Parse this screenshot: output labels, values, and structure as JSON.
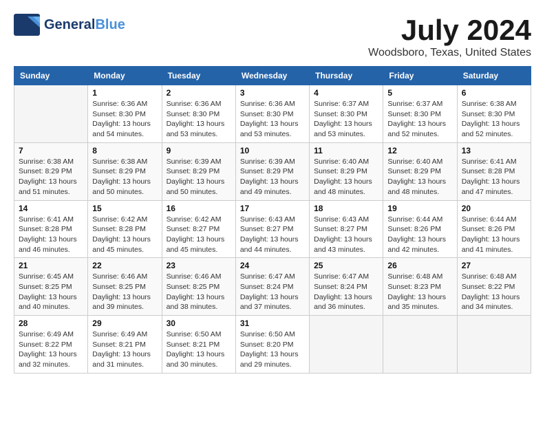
{
  "header": {
    "logo_general": "General",
    "logo_blue": "Blue",
    "month": "July 2024",
    "location": "Woodsboro, Texas, United States"
  },
  "days_of_week": [
    "Sunday",
    "Monday",
    "Tuesday",
    "Wednesday",
    "Thursday",
    "Friday",
    "Saturday"
  ],
  "weeks": [
    [
      {
        "day": "",
        "sunrise": "",
        "sunset": "",
        "daylight": ""
      },
      {
        "day": "1",
        "sunrise": "Sunrise: 6:36 AM",
        "sunset": "Sunset: 8:30 PM",
        "daylight": "Daylight: 13 hours and 54 minutes."
      },
      {
        "day": "2",
        "sunrise": "Sunrise: 6:36 AM",
        "sunset": "Sunset: 8:30 PM",
        "daylight": "Daylight: 13 hours and 53 minutes."
      },
      {
        "day": "3",
        "sunrise": "Sunrise: 6:36 AM",
        "sunset": "Sunset: 8:30 PM",
        "daylight": "Daylight: 13 hours and 53 minutes."
      },
      {
        "day": "4",
        "sunrise": "Sunrise: 6:37 AM",
        "sunset": "Sunset: 8:30 PM",
        "daylight": "Daylight: 13 hours and 53 minutes."
      },
      {
        "day": "5",
        "sunrise": "Sunrise: 6:37 AM",
        "sunset": "Sunset: 8:30 PM",
        "daylight": "Daylight: 13 hours and 52 minutes."
      },
      {
        "day": "6",
        "sunrise": "Sunrise: 6:38 AM",
        "sunset": "Sunset: 8:30 PM",
        "daylight": "Daylight: 13 hours and 52 minutes."
      }
    ],
    [
      {
        "day": "7",
        "sunrise": "Sunrise: 6:38 AM",
        "sunset": "Sunset: 8:29 PM",
        "daylight": "Daylight: 13 hours and 51 minutes."
      },
      {
        "day": "8",
        "sunrise": "Sunrise: 6:38 AM",
        "sunset": "Sunset: 8:29 PM",
        "daylight": "Daylight: 13 hours and 50 minutes."
      },
      {
        "day": "9",
        "sunrise": "Sunrise: 6:39 AM",
        "sunset": "Sunset: 8:29 PM",
        "daylight": "Daylight: 13 hours and 50 minutes."
      },
      {
        "day": "10",
        "sunrise": "Sunrise: 6:39 AM",
        "sunset": "Sunset: 8:29 PM",
        "daylight": "Daylight: 13 hours and 49 minutes."
      },
      {
        "day": "11",
        "sunrise": "Sunrise: 6:40 AM",
        "sunset": "Sunset: 8:29 PM",
        "daylight": "Daylight: 13 hours and 48 minutes."
      },
      {
        "day": "12",
        "sunrise": "Sunrise: 6:40 AM",
        "sunset": "Sunset: 8:29 PM",
        "daylight": "Daylight: 13 hours and 48 minutes."
      },
      {
        "day": "13",
        "sunrise": "Sunrise: 6:41 AM",
        "sunset": "Sunset: 8:28 PM",
        "daylight": "Daylight: 13 hours and 47 minutes."
      }
    ],
    [
      {
        "day": "14",
        "sunrise": "Sunrise: 6:41 AM",
        "sunset": "Sunset: 8:28 PM",
        "daylight": "Daylight: 13 hours and 46 minutes."
      },
      {
        "day": "15",
        "sunrise": "Sunrise: 6:42 AM",
        "sunset": "Sunset: 8:28 PM",
        "daylight": "Daylight: 13 hours and 45 minutes."
      },
      {
        "day": "16",
        "sunrise": "Sunrise: 6:42 AM",
        "sunset": "Sunset: 8:27 PM",
        "daylight": "Daylight: 13 hours and 45 minutes."
      },
      {
        "day": "17",
        "sunrise": "Sunrise: 6:43 AM",
        "sunset": "Sunset: 8:27 PM",
        "daylight": "Daylight: 13 hours and 44 minutes."
      },
      {
        "day": "18",
        "sunrise": "Sunrise: 6:43 AM",
        "sunset": "Sunset: 8:27 PM",
        "daylight": "Daylight: 13 hours and 43 minutes."
      },
      {
        "day": "19",
        "sunrise": "Sunrise: 6:44 AM",
        "sunset": "Sunset: 8:26 PM",
        "daylight": "Daylight: 13 hours and 42 minutes."
      },
      {
        "day": "20",
        "sunrise": "Sunrise: 6:44 AM",
        "sunset": "Sunset: 8:26 PM",
        "daylight": "Daylight: 13 hours and 41 minutes."
      }
    ],
    [
      {
        "day": "21",
        "sunrise": "Sunrise: 6:45 AM",
        "sunset": "Sunset: 8:25 PM",
        "daylight": "Daylight: 13 hours and 40 minutes."
      },
      {
        "day": "22",
        "sunrise": "Sunrise: 6:46 AM",
        "sunset": "Sunset: 8:25 PM",
        "daylight": "Daylight: 13 hours and 39 minutes."
      },
      {
        "day": "23",
        "sunrise": "Sunrise: 6:46 AM",
        "sunset": "Sunset: 8:25 PM",
        "daylight": "Daylight: 13 hours and 38 minutes."
      },
      {
        "day": "24",
        "sunrise": "Sunrise: 6:47 AM",
        "sunset": "Sunset: 8:24 PM",
        "daylight": "Daylight: 13 hours and 37 minutes."
      },
      {
        "day": "25",
        "sunrise": "Sunrise: 6:47 AM",
        "sunset": "Sunset: 8:24 PM",
        "daylight": "Daylight: 13 hours and 36 minutes."
      },
      {
        "day": "26",
        "sunrise": "Sunrise: 6:48 AM",
        "sunset": "Sunset: 8:23 PM",
        "daylight": "Daylight: 13 hours and 35 minutes."
      },
      {
        "day": "27",
        "sunrise": "Sunrise: 6:48 AM",
        "sunset": "Sunset: 8:22 PM",
        "daylight": "Daylight: 13 hours and 34 minutes."
      }
    ],
    [
      {
        "day": "28",
        "sunrise": "Sunrise: 6:49 AM",
        "sunset": "Sunset: 8:22 PM",
        "daylight": "Daylight: 13 hours and 32 minutes."
      },
      {
        "day": "29",
        "sunrise": "Sunrise: 6:49 AM",
        "sunset": "Sunset: 8:21 PM",
        "daylight": "Daylight: 13 hours and 31 minutes."
      },
      {
        "day": "30",
        "sunrise": "Sunrise: 6:50 AM",
        "sunset": "Sunset: 8:21 PM",
        "daylight": "Daylight: 13 hours and 30 minutes."
      },
      {
        "day": "31",
        "sunrise": "Sunrise: 6:50 AM",
        "sunset": "Sunset: 8:20 PM",
        "daylight": "Daylight: 13 hours and 29 minutes."
      },
      {
        "day": "",
        "sunrise": "",
        "sunset": "",
        "daylight": ""
      },
      {
        "day": "",
        "sunrise": "",
        "sunset": "",
        "daylight": ""
      },
      {
        "day": "",
        "sunrise": "",
        "sunset": "",
        "daylight": ""
      }
    ]
  ]
}
